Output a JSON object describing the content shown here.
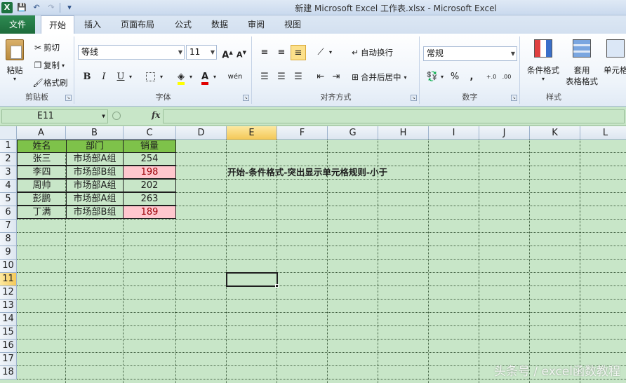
{
  "window": {
    "title": "新建 Microsoft Excel 工作表.xlsx  -  Microsoft Excel",
    "app_icon": "X"
  },
  "quick_access": [
    {
      "icon": "save-icon",
      "glyph": "💾"
    },
    {
      "icon": "undo-icon",
      "glyph": "↶"
    },
    {
      "icon": "redo-icon",
      "glyph": "↷"
    },
    {
      "icon": "customize-icon",
      "glyph": "▾"
    }
  ],
  "tabs": {
    "file": "文件",
    "items": [
      "开始",
      "插入",
      "页面布局",
      "公式",
      "数据",
      "审阅",
      "视图"
    ],
    "active": "开始"
  },
  "ribbon": {
    "clipboard": {
      "label": "剪贴板",
      "paste": "粘贴",
      "cut": "剪切",
      "copy": "复制",
      "format_painter": "格式刷"
    },
    "font": {
      "label": "字体",
      "font_name": "等线",
      "font_size": "11",
      "grow": "A",
      "shrink": "A",
      "bold": "B",
      "italic": "I",
      "underline": "U",
      "phonetic": "wén"
    },
    "alignment": {
      "label": "对齐方式",
      "wrap_text": "自动换行",
      "merge_center": "合并后居中"
    },
    "number": {
      "label": "数字",
      "format": "常规",
      "percent": "%",
      "comma": ",",
      "inc_decimal": "+.0",
      "dec_decimal": ".00"
    },
    "styles": {
      "label": "样式",
      "conditional_format": "条件格式",
      "table_format_line1": "套用",
      "table_format_line2": "表格格式",
      "cell_styles": "单元格"
    }
  },
  "formula_bar": {
    "name_box": "E11",
    "fx": "fx",
    "value": ""
  },
  "columns": [
    "A",
    "B",
    "C",
    "D",
    "E",
    "F",
    "G",
    "H",
    "I",
    "J",
    "K",
    "L"
  ],
  "selected_column": "E",
  "rows": [
    "1",
    "2",
    "3",
    "4",
    "5",
    "6",
    "7",
    "8",
    "9",
    "10",
    "11",
    "12",
    "13",
    "14",
    "15",
    "16",
    "17",
    "18"
  ],
  "selected_row": "11",
  "table": {
    "headers": [
      "姓名",
      "部门",
      "销量"
    ],
    "rows": [
      [
        "张三",
        "市场部A组",
        "254"
      ],
      [
        "李四",
        "市场部B组",
        "198"
      ],
      [
        "周帅",
        "市场部A组",
        "202"
      ],
      [
        "彭鹏",
        "市场部A组",
        "263"
      ],
      [
        "丁满",
        "市场部B组",
        "189"
      ]
    ],
    "highlight_color": "#ffc7ce",
    "header_color": "#7ec24a"
  },
  "note": "开始-条件格式-突出显示单元格规则-小于",
  "watermark": "头条号 / excel函数教程",
  "colors": {
    "sheet_bg": "#c8e6c8",
    "file_tab": "#1d6b3b",
    "selected_header": "#f4c95a"
  }
}
